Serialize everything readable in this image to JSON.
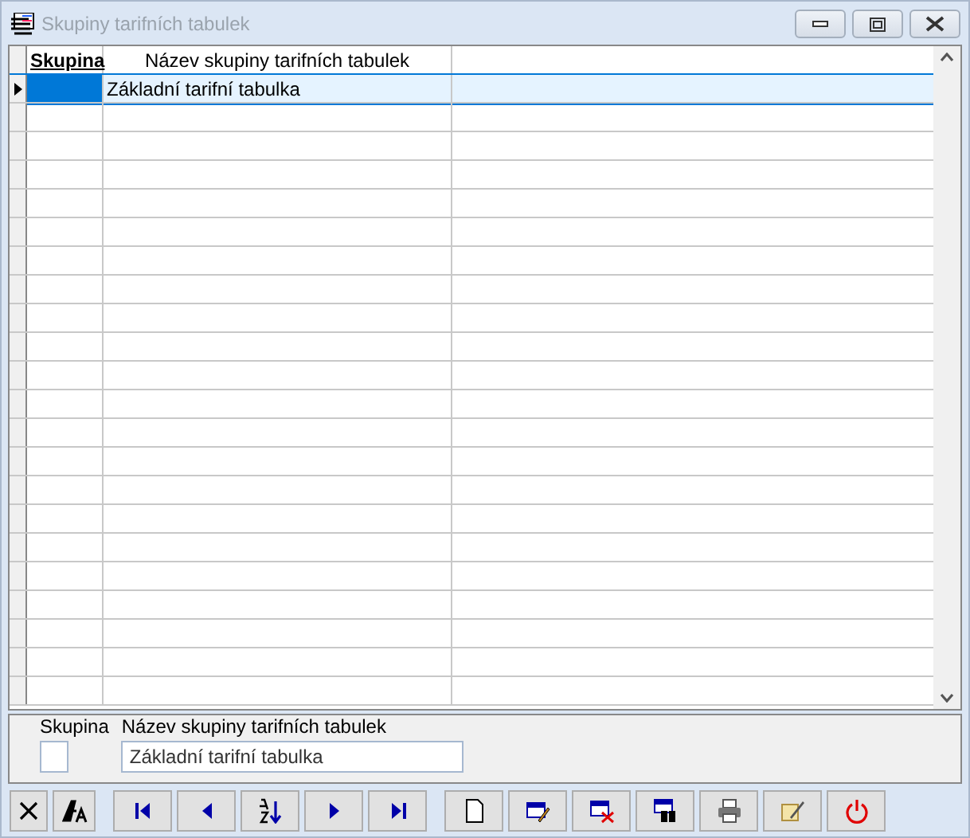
{
  "window": {
    "title": "Skupiny tarifních tabulek"
  },
  "grid": {
    "columns": [
      "Skupina",
      "Název  skupiny tarifních tabulek"
    ],
    "rows": [
      {
        "cells": [
          "",
          "Základní tarifní tabulka"
        ],
        "selected": true
      }
    ]
  },
  "detail": {
    "fields": [
      {
        "label": "Skupina"
      },
      {
        "label": "Název  skupiny tarifních tabulek",
        "value": "Základní tarifní tabulka"
      }
    ]
  },
  "toolbar": [
    {
      "kind": "cancel"
    },
    {
      "kind": "font"
    },
    {
      "kind": "first"
    },
    {
      "kind": "prev"
    },
    {
      "kind": "sort"
    },
    {
      "kind": "next"
    },
    {
      "kind": "last"
    },
    {
      "kind": "new"
    },
    {
      "kind": "edit"
    },
    {
      "kind": "delete"
    },
    {
      "kind": "find"
    },
    {
      "kind": "print"
    },
    {
      "kind": "tools"
    },
    {
      "kind": "power"
    }
  ]
}
